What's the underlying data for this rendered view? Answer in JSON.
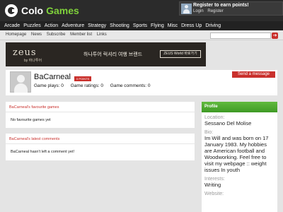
{
  "brand": {
    "part1": "Colo",
    "part2": "Games"
  },
  "header": {
    "earn_title": "Register to earn points!",
    "login": "Login",
    "register": "Register"
  },
  "nav": [
    "Arcade",
    "Puzzles",
    "Action",
    "Adventure",
    "Strategy",
    "Shooting",
    "Sports",
    "Flying",
    "Misc",
    "Dress Up",
    "Driving"
  ],
  "subnav": [
    "Homepage",
    "News",
    "Subscribe",
    "Member list",
    "Links"
  ],
  "banner": {
    "logo": "zeus",
    "sub": "by 하나투어",
    "text": "하나투어 럭셔리 여행 브랜드",
    "button": "ZEUS World 바로가기"
  },
  "profile": {
    "username": "BaCarneal",
    "points_badge": "0 POINTS",
    "game_plays": "Game plays: 0",
    "game_ratings": "Game ratings: 0",
    "game_comments": "Game comments: 0",
    "send_message": "Send a message"
  },
  "favourites": {
    "title": "BaCarneal's favourite games",
    "body": "No favourite games yet"
  },
  "comments": {
    "title": "BaCarneal's latest comments",
    "body": "BaCarneal hasn't left a comment yet!"
  },
  "side": {
    "title": "Profile",
    "location_label": "Location:",
    "location": "Sessano Del Molise",
    "bio_label": "Bio:",
    "bio": "Im Will and was born on 17 January 1983. My hobbies are American football and Woodworking. Feel free to visit my webpage :: weight issues In youth",
    "interests_label": "Interests:",
    "interests": "Writing",
    "website_label": "Website:"
  },
  "colors": {
    "accent_red": "#c9302c",
    "brand_green": "#7fd13b",
    "panel_green": "#3f9a25"
  }
}
